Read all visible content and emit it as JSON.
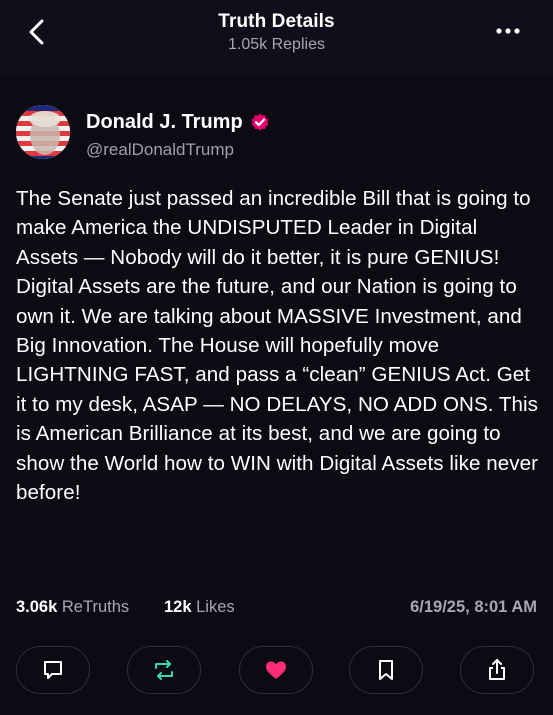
{
  "header": {
    "title": "Truth Details",
    "subtitle": "1.05k Replies"
  },
  "author": {
    "display_name": "Donald J. Trump",
    "handle": "@realDonaldTrump",
    "verified": true,
    "verified_color": "#e6006d"
  },
  "post": {
    "text": "The Senate just passed an incredible Bill that is going to make America the UNDISPUTED Leader in Digital Assets — Nobody will do it better, it is pure GENIUS! Digital Assets are the future, and our Nation is going to own it. We are talking about MASSIVE Investment, and Big Innovation. The House will hopefully move LIGHTNING FAST, and pass a “clean” GENIUS Act. Get it to my desk, ASAP — NO DELAYS, NO ADD ONS. This is American Brilliance at its best, and we are going to show the World how to WIN with Digital Assets like never before!"
  },
  "stats": {
    "retruths_count": "3.06k",
    "retruths_label": "ReTruths",
    "likes_count": "12k",
    "likes_label": "Likes",
    "timestamp": "6/19/25, 8:01 AM"
  },
  "actions": [
    {
      "name": "reply",
      "icon": "comment-icon"
    },
    {
      "name": "retruth",
      "icon": "retruth-icon",
      "color": "#3ed6b0"
    },
    {
      "name": "like",
      "icon": "heart-icon",
      "color": "#ff2d78"
    },
    {
      "name": "bookmark",
      "icon": "bookmark-icon"
    },
    {
      "name": "share",
      "icon": "share-icon"
    }
  ]
}
